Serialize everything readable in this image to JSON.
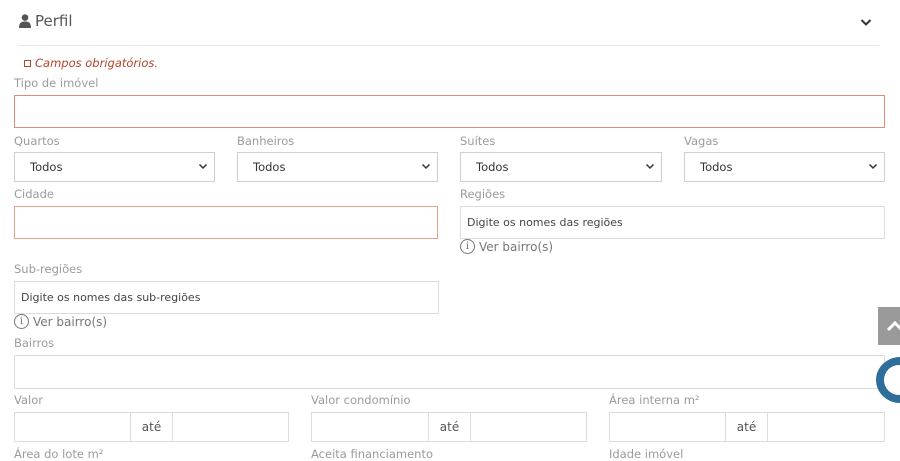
{
  "header": {
    "title": "Perfil"
  },
  "required_note": "Campos obrigatórios.",
  "fields": {
    "tipo_imovel": {
      "label": "Tipo de imóvel",
      "value": ""
    },
    "quartos": {
      "label": "Quartos",
      "value": "Todos"
    },
    "banheiros": {
      "label": "Banheiros",
      "value": "Todos"
    },
    "suites": {
      "label": "Suítes",
      "value": "Todos"
    },
    "vagas": {
      "label": "Vagas",
      "value": "Todos"
    },
    "cidade": {
      "label": "Cidade",
      "value": ""
    },
    "regioes": {
      "label": "Regiões",
      "placeholder": "Digite os nomes das regiões",
      "hint": "Ver bairro(s)"
    },
    "sub_regioes": {
      "label": "Sub-regiões",
      "placeholder": "Digite os nomes das sub-regiões",
      "hint": "Ver bairro(s)"
    },
    "bairros": {
      "label": "Bairros",
      "value": ""
    },
    "valor": {
      "label": "Valor",
      "sep": "até"
    },
    "valor_condominio": {
      "label": "Valor condomínio",
      "sep": "até"
    },
    "area_interna": {
      "label": "Área interna m²",
      "sep": "até"
    },
    "area_lote": {
      "label": "Área do lote m²"
    },
    "aceita_financiamento": {
      "label": "Aceita financiamento"
    },
    "idade_imovel": {
      "label": "Idade imóvel"
    }
  },
  "icons": {
    "header": "user-icon",
    "collapse": "chevron-down-icon",
    "info": "info-icon",
    "scroll_top": "caret-up-icon",
    "chat": "chat-icon"
  },
  "colors": {
    "required": "#b4452c",
    "error_border": "#e08b7a",
    "chat": "#2f6e9b"
  }
}
